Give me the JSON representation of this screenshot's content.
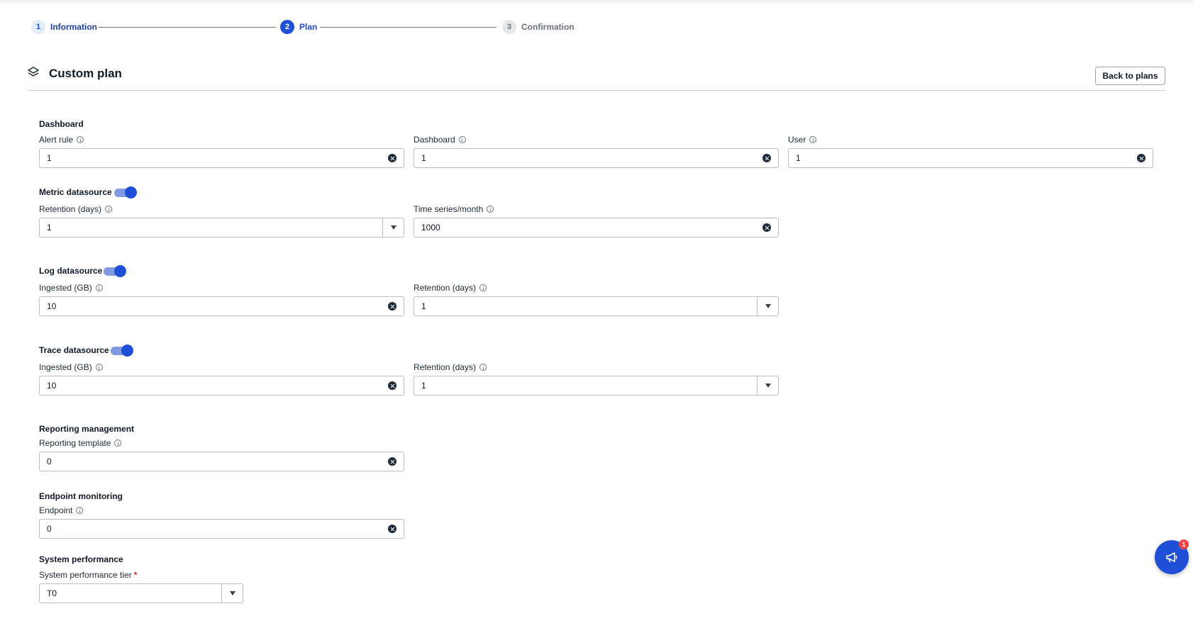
{
  "stepper": {
    "steps": [
      {
        "number": "1",
        "label": "Information"
      },
      {
        "number": "2",
        "label": "Plan"
      },
      {
        "number": "3",
        "label": "Confirmation"
      }
    ]
  },
  "header": {
    "title": "Custom plan",
    "icon": "layers-icon",
    "back_button": "Back to plans"
  },
  "sections": {
    "dashboard": {
      "title": "Dashboard",
      "alert_rule": {
        "label": "Alert rule",
        "value": "1"
      },
      "dashboard": {
        "label": "Dashboard",
        "value": "1"
      },
      "user": {
        "label": "User",
        "value": "1"
      }
    },
    "metric": {
      "title": "Metric datasource",
      "enabled": true,
      "retention": {
        "label": "Retention (days)",
        "value": "1"
      },
      "time_series": {
        "label": "Time series/month",
        "value": "1000"
      }
    },
    "log": {
      "title": "Log datasource",
      "enabled": true,
      "ingested": {
        "label": "Ingested (GB)",
        "value": "10"
      },
      "retention": {
        "label": "Retention (days)",
        "value": "1"
      }
    },
    "trace": {
      "title": "Trace datasource",
      "enabled": true,
      "ingested": {
        "label": "Ingested (GB)",
        "value": "10"
      },
      "retention": {
        "label": "Retention (days)",
        "value": "1"
      }
    },
    "reporting": {
      "title": "Reporting management",
      "template": {
        "label": "Reporting template",
        "value": "0"
      }
    },
    "endpoint": {
      "title": "Endpoint monitoring",
      "endpoint": {
        "label": "Endpoint",
        "value": "0"
      }
    },
    "system": {
      "title": "System performance",
      "tier": {
        "label": "System performance tier",
        "required_mark": "*",
        "value": "T0"
      }
    }
  },
  "fab": {
    "icon": "megaphone-icon",
    "badge": "1"
  },
  "colors": {
    "accent": "#1e4fd6",
    "badge": "#ef4444"
  }
}
